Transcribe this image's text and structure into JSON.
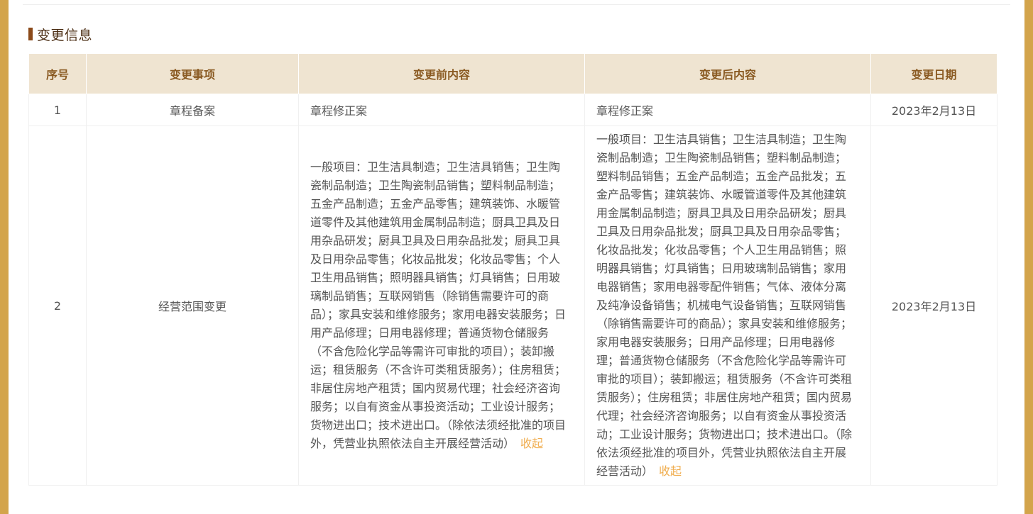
{
  "section": {
    "title": "变更信息"
  },
  "table": {
    "headers": {
      "index": "序号",
      "item": "变更事项",
      "before": "变更前内容",
      "after": "变更后内容",
      "date": "变更日期"
    },
    "rows": [
      {
        "index": "1",
        "item": "章程备案",
        "before": "章程修正案",
        "after": "章程修正案",
        "date": "2023年2月13日"
      },
      {
        "index": "2",
        "item": "经营范围变更",
        "before": "一般项目：卫生洁具制造；卫生洁具销售；卫生陶瓷制品制造；卫生陶瓷制品销售；塑料制品制造；五金产品制造；五金产品零售；建筑装饰、水暖管道零件及其他建筑用金属制品制造；厨具卫具及日用杂品研发；厨具卫具及日用杂品批发；厨具卫具及日用杂品零售；化妆品批发；化妆品零售；个人卫生用品销售；照明器具销售；灯具销售；日用玻璃制品销售；互联网销售（除销售需要许可的商品）；家具安装和维修服务；家用电器安装服务；日用产品修理；日用电器修理；普通货物仓储服务（不含危险化学品等需许可审批的项目）；装卸搬运；租赁服务（不含许可类租赁服务）；住房租赁；非居住房地产租赁；国内贸易代理；社会经济咨询服务；以自有资金从事投资活动；工业设计服务；货物进出口；技术进出口。（除依法须经批准的项目外，凭营业执照依法自主开展经营活动）",
        "before_toggle": "收起",
        "after": "一般项目：卫生洁具销售；卫生洁具制造；卫生陶瓷制品制造；卫生陶瓷制品销售；塑料制品制造；塑料制品销售；五金产品制造；五金产品批发；五金产品零售；建筑装饰、水暖管道零件及其他建筑用金属制品制造；厨具卫具及日用杂品研发；厨具卫具及日用杂品批发；厨具卫具及日用杂品零售；化妆品批发；化妆品零售；个人卫生用品销售；照明器具销售；灯具销售；日用玻璃制品销售；家用电器销售；家用电器零配件销售；气体、液体分离及纯净设备销售；机械电气设备销售；互联网销售（除销售需要许可的商品）；家具安装和维修服务；家用电器安装服务；日用产品修理；日用电器修理；普通货物仓储服务（不含危险化学品等需许可审批的项目）；装卸搬运；租赁服务（不含许可类租赁服务）；住房租赁；非居住房地产租赁；国内贸易代理；社会经济咨询服务；以自有资金从事投资活动；工业设计服务；货物进出口；技术进出口。（除依法须经批准的项目外，凭营业执照依法自主开展经营活动）",
        "after_toggle": "收起",
        "date": "2023年2月13日"
      }
    ]
  },
  "colors": {
    "frame_border": "#d3a44b",
    "header_bg": "#efe4d1",
    "header_text": "#8a5a22",
    "title_bar": "#8b4a1a",
    "link": "#f0ad4e"
  }
}
